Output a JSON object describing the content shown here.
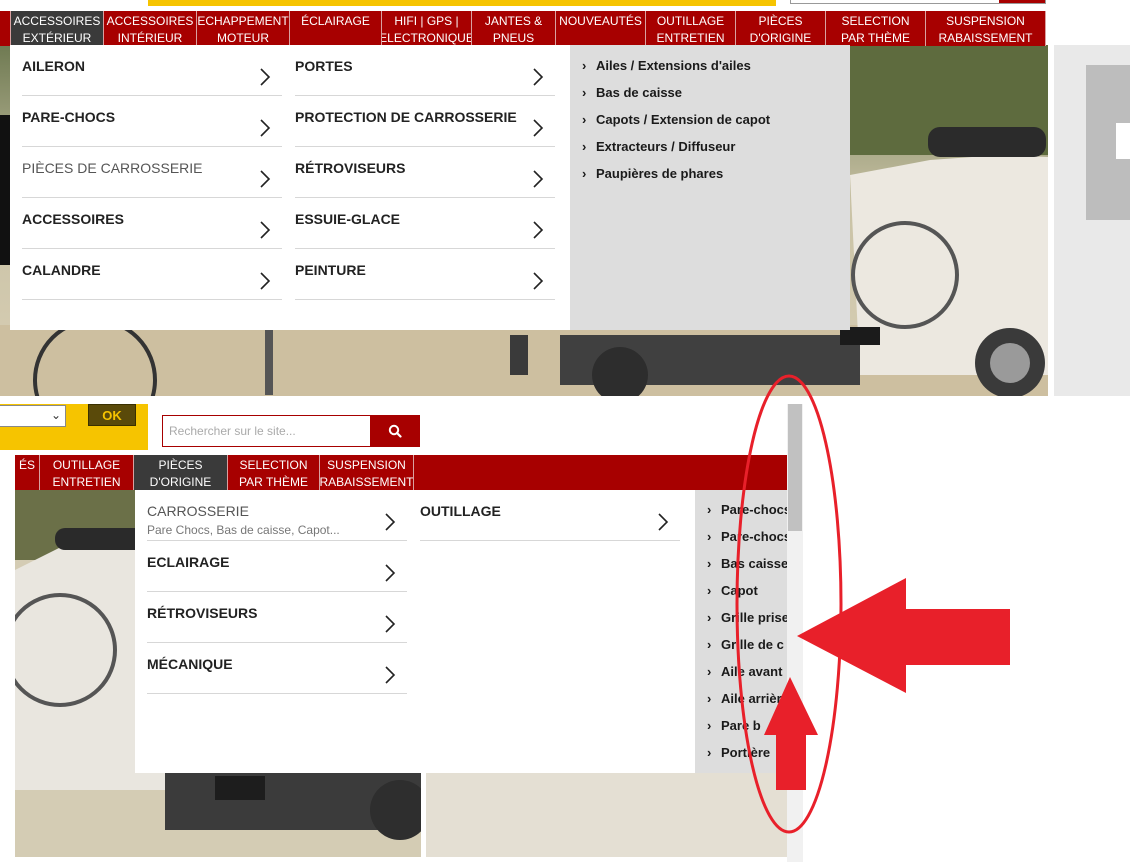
{
  "top": {
    "nav": [
      {
        "l1": "",
        "l2": "",
        "id": "edge"
      },
      {
        "l1": "ACCESSOIRES",
        "l2": "EXTÉRIEUR",
        "id": "accessoires-exterieur",
        "active": true
      },
      {
        "l1": "ACCESSOIRES",
        "l2": "INTÉRIEUR",
        "id": "accessoires-interieur"
      },
      {
        "l1": "ECHAPPEMENT",
        "l2": "MOTEUR",
        "id": "echappement-moteur"
      },
      {
        "l1": "ÉCLAIRAGE",
        "l2": "",
        "id": "eclairage"
      },
      {
        "l1": "HIFI | GPS |",
        "l2": "ELECTRONIQUE",
        "id": "hifi-gps"
      },
      {
        "l1": "JANTES &",
        "l2": "PNEUS",
        "id": "jantes-pneus"
      },
      {
        "l1": "NOUVEAUTÉS",
        "l2": "",
        "id": "nouveautes"
      },
      {
        "l1": "OUTILLAGE",
        "l2": "ENTRETIEN",
        "id": "outillage-entretien"
      },
      {
        "l1": "PIÈCES",
        "l2": "D'ORIGINE",
        "id": "pieces-origine"
      },
      {
        "l1": "SELECTION",
        "l2": "PAR THÈME",
        "id": "selection-theme"
      },
      {
        "l1": "SUSPENSION",
        "l2": "RABAISSEMENT",
        "id": "suspension"
      }
    ],
    "menu_col1": [
      {
        "label": "AILERON"
      },
      {
        "label": "PARE-CHOCS"
      },
      {
        "label": "PIÈCES DE CARROSSERIE",
        "muted": true
      },
      {
        "label": "ACCESSOIRES"
      },
      {
        "label": "CALANDRE"
      }
    ],
    "menu_col2": [
      {
        "label": "PORTES"
      },
      {
        "label": "PROTECTION DE CARROSSERIE"
      },
      {
        "label": "RÉTROVISEURS"
      },
      {
        "label": "ESSUIE-GLACE"
      },
      {
        "label": "PEINTURE"
      }
    ],
    "sub_links": [
      "Ailes / Extensions d'ailes",
      "Bas de caisse",
      "Capots / Extension de capot",
      "Extracteurs / Diffuseur",
      "Paupières de phares"
    ]
  },
  "bottom": {
    "ok_label": "OK",
    "search_placeholder": "Rechercher sur le site...",
    "nav": [
      {
        "l1": "ÉS",
        "l2": "",
        "id": "edge"
      },
      {
        "l1": "OUTILLAGE",
        "l2": "ENTRETIEN",
        "id": "outillage-entretien"
      },
      {
        "l1": "PIÈCES",
        "l2": "D'ORIGINE",
        "id": "pieces-origine",
        "active": true
      },
      {
        "l1": "SELECTION",
        "l2": "PAR THÈME",
        "id": "selection-theme"
      },
      {
        "l1": "SUSPENSION",
        "l2": "RABAISSEMENT",
        "id": "suspension"
      }
    ],
    "menu_col1": [
      {
        "label": "CARROSSERIE",
        "sub": "Pare Chocs, Bas de caisse, Capot...",
        "muted": true
      },
      {
        "label": "ECLAIRAGE"
      },
      {
        "label": "RÉTROVISEURS"
      },
      {
        "label": "MÉCANIQUE"
      }
    ],
    "menu_col2": [
      {
        "label": "OUTILLAGE"
      }
    ],
    "sub_links": [
      "Pare-chocs",
      "Pare-chocs",
      "Bas caisse",
      "Capot",
      "Grille prise",
      "Grille de c",
      "Aile avant",
      "Aile arrière",
      "Pare b",
      "Portière"
    ]
  },
  "colors": {
    "nav_red": "#a70000",
    "nav_active": "#3a3a3a",
    "yellow": "#f6c400",
    "annotation_red": "#e8202a",
    "side_panel": "#dddddd"
  },
  "icons": [
    "chevron-right-icon",
    "search-icon",
    "chevron-down-icon",
    "caret-right-icon"
  ]
}
